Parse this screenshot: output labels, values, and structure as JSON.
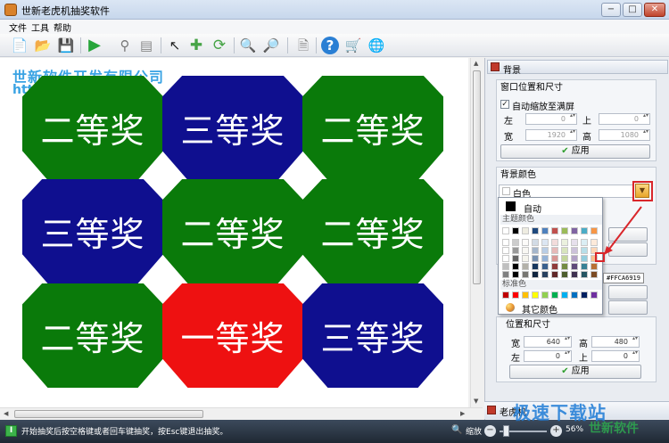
{
  "window": {
    "title": "世新老虎机抽奖软件",
    "minimize": "−",
    "maximize": "□",
    "close": "✕"
  },
  "menu": [
    "文件",
    "工具",
    "帮助"
  ],
  "toolbar": {
    "icons": [
      "new-file-icon",
      "open-folder-icon",
      "save-icon",
      "play-icon",
      "filter-icon",
      "database-icon",
      "pointer-icon",
      "move-icon",
      "refresh-icon",
      "zoom-in-icon",
      "zoom-out-icon",
      "page-icon",
      "help-icon",
      "cart-icon",
      "globe-icon"
    ]
  },
  "canvas": {
    "company": "世新软件开发有限公司",
    "company_url": "http",
    "prizes": [
      {
        "label": "二等奖",
        "color": "#0a7a0a"
      },
      {
        "label": "三等奖",
        "color": "#0f0f8f"
      },
      {
        "label": "二等奖",
        "color": "#0a7a0a"
      },
      {
        "label": "三等奖",
        "color": "#0f0f8f"
      },
      {
        "label": "二等奖",
        "color": "#0a7a0a"
      },
      {
        "label": "二等奖",
        "color": "#0a7a0a"
      },
      {
        "label": "二等奖",
        "color": "#0a7a0a"
      },
      {
        "label": "一等奖",
        "color": "#ee1111"
      },
      {
        "label": "三等奖",
        "color": "#0f0f8f"
      }
    ]
  },
  "panel": {
    "header": "背景",
    "window_group": {
      "title": "窗口位置和尺寸",
      "auto_scale_label": "自动缩放至满屏",
      "auto_scale_checked": true,
      "left_label": "左",
      "left_value": "0",
      "top_label": "上",
      "top_value": "0",
      "width_label": "宽",
      "width_value": "1920",
      "height_label": "高",
      "height_value": "1080",
      "apply": "应用"
    },
    "bg_color_group": {
      "title": "背景颜色",
      "selected": "白色"
    },
    "popup": {
      "auto_label": "自动",
      "theme_label": "主题颜色",
      "standard_label": "标准色",
      "more_label": "其它颜色",
      "tooltip": "#FFCA6919",
      "theme_top": [
        "#ffffff",
        "#000000",
        "#eeece1",
        "#1f497d",
        "#4f81bd",
        "#c0504d",
        "#9bbb59",
        "#8064a2",
        "#4bacc6",
        "#f79646"
      ],
      "standard": [
        "#c00000",
        "#ff0000",
        "#ffc000",
        "#ffff00",
        "#92d050",
        "#00b050",
        "#00b0f0",
        "#0070c0",
        "#002060",
        "#7030a0"
      ]
    },
    "pos_group": {
      "title": "位置和尺寸",
      "width_label": "宽",
      "width_value": "640",
      "height_label": "高",
      "height_value": "480",
      "left_label": "左",
      "left_value": "0",
      "top_label": "上",
      "top_value": "0",
      "apply": "应用"
    },
    "footer": "老虎机"
  },
  "status": {
    "text": "开始抽奖后按空格键或者回车键抽奖，按Esc键退出抽奖。",
    "zoom_label": "缩放",
    "zoom_pct": "56%",
    "zoom_out": "−",
    "zoom_in": "+"
  },
  "watermark": {
    "line1": "极速下载站",
    "line2": "世新软件"
  }
}
